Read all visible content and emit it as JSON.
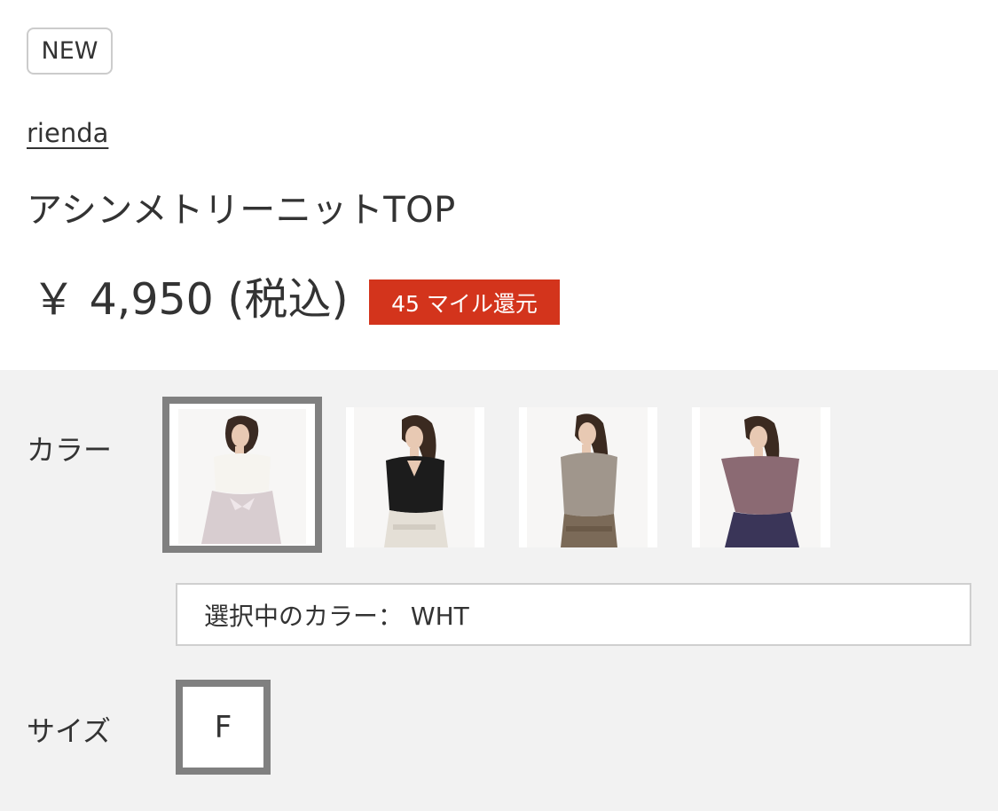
{
  "product": {
    "badge": "NEW",
    "brand": "rienda",
    "title": "アシンメトリーニットTOP",
    "price": "￥ 4,950 (税込)",
    "miles": "45 マイル還元"
  },
  "color_section": {
    "label": "カラー",
    "swatches": [
      {
        "top_color": "#f6f4ef",
        "bottom_color": "#d8cdd0",
        "selected": true
      },
      {
        "top_color": "#1c1c1c",
        "bottom_color": "#e4dfd6",
        "selected": false
      },
      {
        "top_color": "#a0968c",
        "bottom_color": "#7b6a58",
        "selected": false
      },
      {
        "top_color": "#8b6a73",
        "bottom_color": "#3a3558",
        "selected": false
      }
    ],
    "selected_text": "選択中のカラー： WHT"
  },
  "size_section": {
    "label": "サイズ",
    "options": [
      "F"
    ]
  },
  "colors": {
    "accent_red": "#d3341c",
    "selection_border": "#808080",
    "panel_background": "#f2f2f2"
  }
}
